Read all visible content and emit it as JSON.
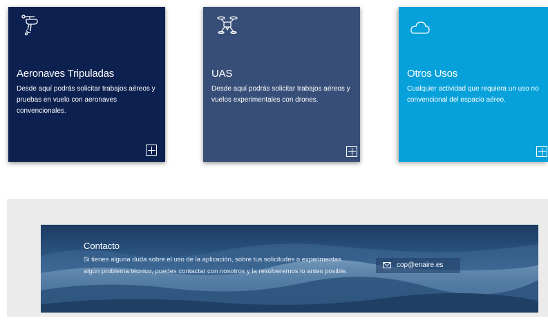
{
  "cards": [
    {
      "title": "Aeronaves Tripuladas",
      "description": "Desde aquí podrás solicitar trabajos aéreos y pruebas en vuelo con aeronaves convencionales.",
      "icon": "helicopter-icon",
      "color": "#0d2150"
    },
    {
      "title": "UAS",
      "description": "Desde aquí podrás solicitar trabajos aéreos y vuelos experimentales con drones.",
      "icon": "drone-icon",
      "color": "#374f78"
    },
    {
      "title": "Otros Usos",
      "description": "Cualquier actividad que requiera un uso no convencional del espacio aéreo.",
      "icon": "cloud-icon",
      "color": "#06a1da"
    }
  ],
  "contact": {
    "title": "Contacto",
    "text": "Si tienes alguna duda sobre el uso de la aplicación, sobre tus solicitudes o experimentas algún problema técnico, puedes contactar con nosotros y la resolveremos lo antes posible.",
    "email": "cop@enaire.es",
    "email_icon": "envelope-icon"
  }
}
